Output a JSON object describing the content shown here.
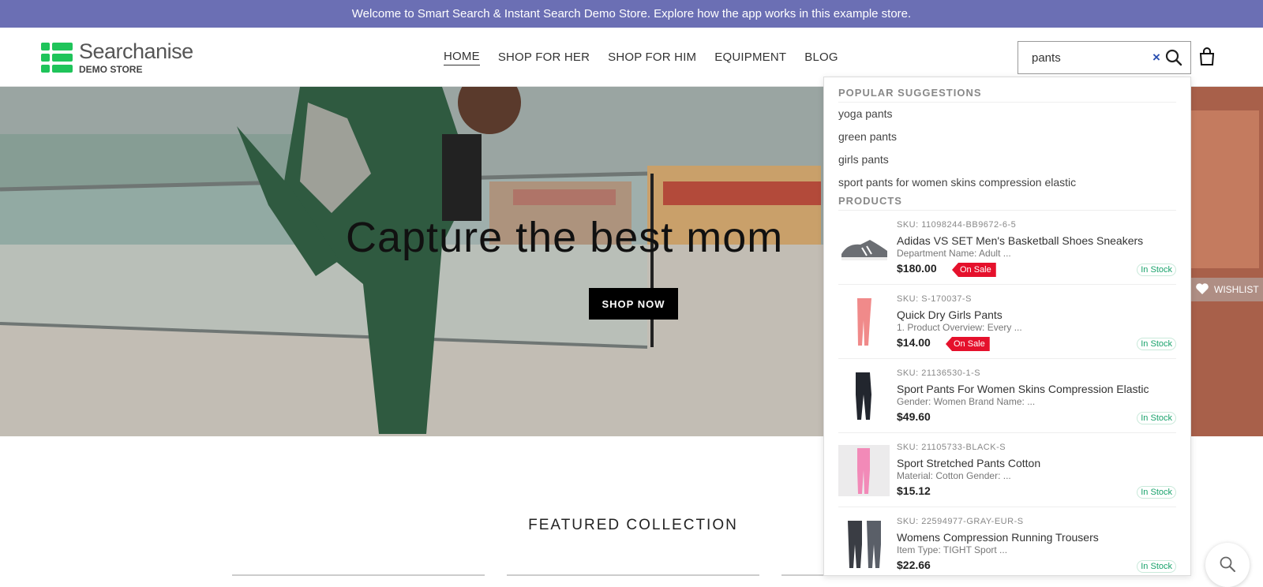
{
  "announcement": "Welcome to Smart Search & Instant Search Demo Store. Explore how the app works in this example store.",
  "logo": {
    "name": "Searchanise",
    "sub": "DEMO STORE"
  },
  "nav": [
    {
      "label": "HOME",
      "active": true
    },
    {
      "label": "SHOP FOR HER",
      "active": false
    },
    {
      "label": "SHOP FOR HIM",
      "active": false
    },
    {
      "label": "EQUIPMENT",
      "active": false
    },
    {
      "label": "BLOG",
      "active": false
    }
  ],
  "search": {
    "value": "pants",
    "clear_icon": "×"
  },
  "hero": {
    "title": "Capture the best mom",
    "button": "SHOP NOW",
    "wishlist": "WISHLIST"
  },
  "featured": "FEATURED COLLECTION",
  "dropdown": {
    "suggestions_heading": "POPULAR SUGGESTIONS",
    "suggestions": [
      "yoga pants",
      "green pants",
      "girls pants",
      "sport pants for women skins compression elastic"
    ],
    "products_heading": "PRODUCTS",
    "products": [
      {
        "sku": "SKU: 11098244-BB9672-6-5",
        "name": "Adidas VS SET Men's Basketball Shoes Sneakers",
        "desc": "Department Name: Adult ...",
        "price": "$180.00",
        "sale": "On Sale",
        "stock": "In Stock",
        "thumb": "shoe"
      },
      {
        "sku": "SKU: S-170037-S",
        "name": "Quick Dry Girls Pants",
        "desc": "1. Product Overview: Every ...",
        "price": "$14.00",
        "sale": "On Sale",
        "stock": "In Stock",
        "thumb": "pink-pants"
      },
      {
        "sku": "SKU: 21136530-1-S",
        "name": "Sport Pants For Women Skins Compression Elastic",
        "desc": "Gender: Women Brand Name: ...",
        "price": "$49.60",
        "sale": "",
        "stock": "In Stock",
        "thumb": "black-leggings"
      },
      {
        "sku": "SKU: 21105733-BLACK-S",
        "name": "Sport Stretched Pants Cotton",
        "desc": "Material: Cotton Gender: ...",
        "price": "$15.12",
        "sale": "",
        "stock": "In Stock",
        "thumb": "pink-stretch-pants"
      },
      {
        "sku": "SKU: 22594977-GRAY-EUR-S",
        "name": "Womens Compression Running Trousers",
        "desc": "Item Type: TIGHT Sport ...",
        "price": "$22.66",
        "sale": "",
        "stock": "In Stock",
        "thumb": "gray-trousers"
      }
    ]
  },
  "colors": {
    "announce_bg": "#6b6fb4",
    "brand_green": "#1fc45a",
    "sale_red": "#e5112c",
    "stock_green": "#1aa36c",
    "clear_blue": "#2a4fb0"
  }
}
